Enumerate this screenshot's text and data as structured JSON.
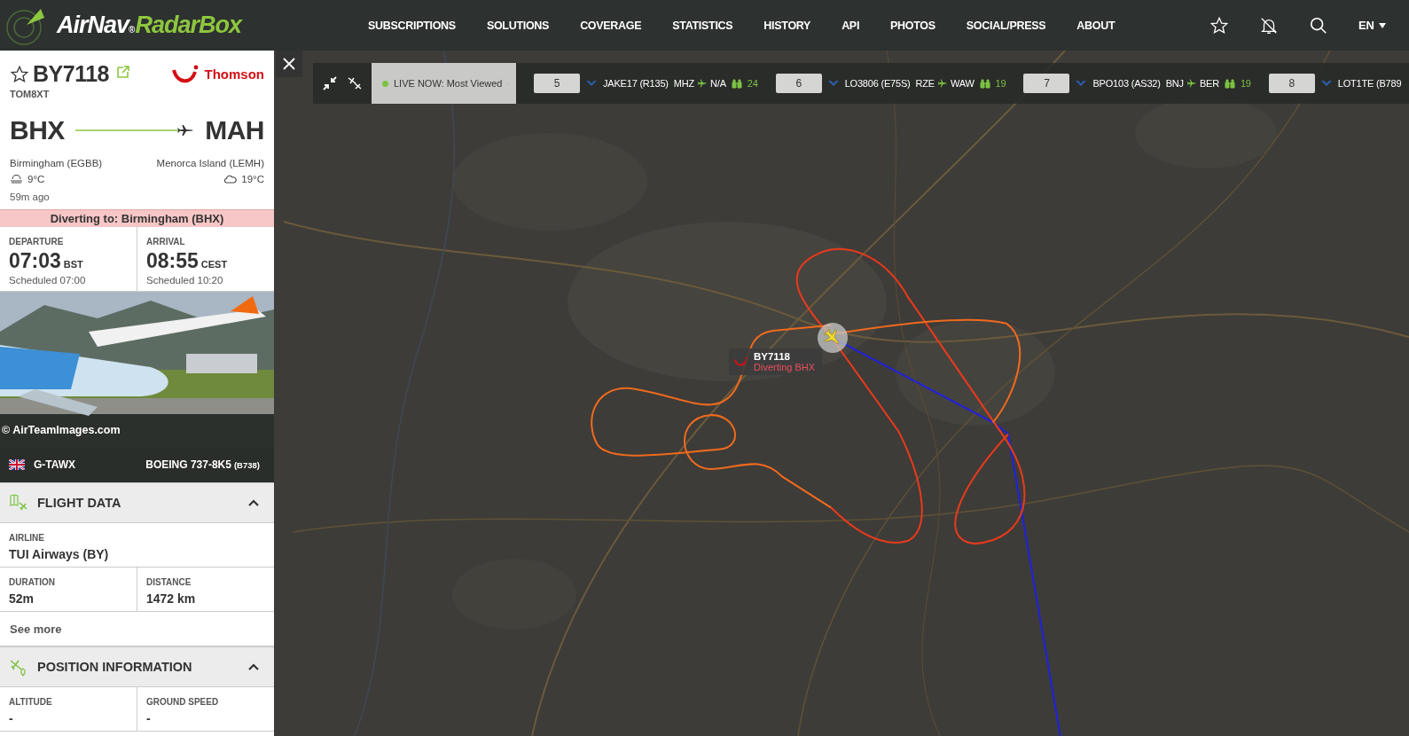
{
  "header": {
    "logo": {
      "part_1": "AirNav",
      "mark": "®",
      "part_2": "RadarBox"
    },
    "nav": [
      "SUBSCRIPTIONS",
      "SOLUTIONS",
      "COVERAGE",
      "STATISTICS",
      "HISTORY",
      "API",
      "PHOTOS",
      "SOCIAL/PRESS",
      "ABOUT"
    ],
    "language": "EN"
  },
  "live_strip": {
    "filter": "LIVE NOW: Most Viewed",
    "flights": [
      {
        "rank": "5",
        "callsign": "JAKE17 (R135)",
        "origin": "MHZ",
        "destination": "N/A",
        "viewers": "24"
      },
      {
        "rank": "6",
        "callsign": "LO3806 (E75S)",
        "origin": "RZE",
        "destination": "WAW",
        "viewers": "19"
      },
      {
        "rank": "7",
        "callsign": "BPO103 (AS32)",
        "origin": "BNJ",
        "destination": "BER",
        "viewers": "19"
      },
      {
        "rank": "8",
        "callsign": "LOT1TE (B789"
      }
    ]
  },
  "flight": {
    "callsign": "BY7118",
    "registration_code": "TOM8XT",
    "airline_name": "Thomson",
    "origin": {
      "code": "BHX",
      "name": "Birmingham (EGBB)",
      "temperature": "9°C"
    },
    "destination": {
      "code": "MAH",
      "name": "Menorca Island (LEMH)",
      "temperature": "19°C"
    },
    "updated": "59m ago",
    "alert": "Diverting to: Birmingham (BHX)",
    "departure": {
      "label": "DEPARTURE",
      "time": "07:03",
      "zone": "BST",
      "scheduled": "Scheduled 07:00"
    },
    "arrival": {
      "label": "ARRIVAL",
      "time": "08:55",
      "zone": "CEST",
      "scheduled": "Scheduled 10:20"
    },
    "photo_credit": "© AirTeamImages.com",
    "aircraft": {
      "registration": "G-TAWX",
      "type": "BOEING 737-8K5",
      "type_code": "(B738)"
    }
  },
  "sections": [
    {
      "kind": "flight",
      "title": "FLIGHT DATA",
      "expanded": true,
      "rows": [
        [
          {
            "label": "AIRLINE",
            "value": "TUI Airways (BY)"
          }
        ],
        [
          {
            "label": "DURATION",
            "value": "52m"
          },
          {
            "label": "DISTANCE",
            "value": "1472 km"
          }
        ]
      ],
      "link": "See more"
    },
    {
      "kind": "position",
      "title": "POSITION INFORMATION",
      "expanded": true,
      "rows": [
        [
          {
            "label": "ALTITUDE",
            "value": "-"
          },
          {
            "label": "GROUND SPEED",
            "value": "-"
          }
        ]
      ]
    }
  ],
  "map": {
    "flight_tag": {
      "callsign": "BY7118",
      "status": "Diverting BHX"
    }
  }
}
